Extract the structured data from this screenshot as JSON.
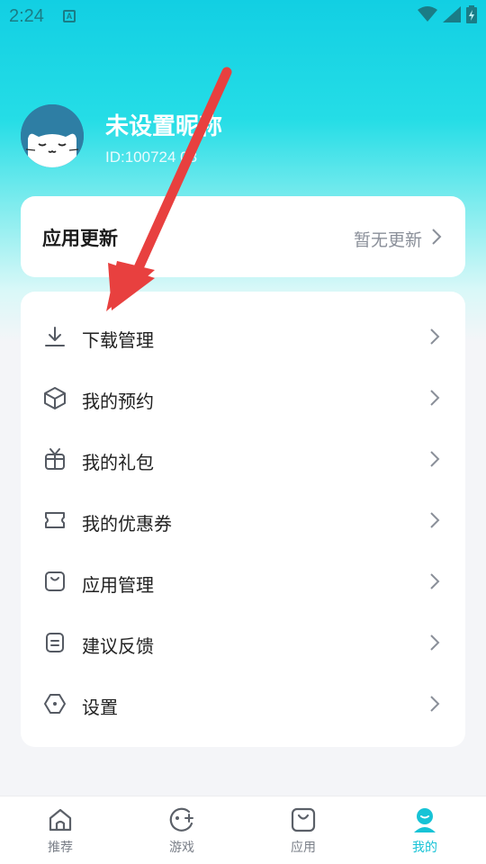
{
  "status_bar": {
    "time": "2:24",
    "badge": "A"
  },
  "profile": {
    "nickname": "未设置昵称",
    "user_id": "ID:100724 03"
  },
  "update_card": {
    "title": "应用更新",
    "status": "暂无更新"
  },
  "menu": {
    "items": [
      {
        "label": "下载管理",
        "icon": "download-icon"
      },
      {
        "label": "我的预约",
        "icon": "box-icon"
      },
      {
        "label": "我的礼包",
        "icon": "gift-icon"
      },
      {
        "label": "我的优惠券",
        "icon": "ticket-icon"
      },
      {
        "label": "应用管理",
        "icon": "bag-icon"
      },
      {
        "label": "建议反馈",
        "icon": "feedback-icon"
      },
      {
        "label": "设置",
        "icon": "settings-icon"
      }
    ]
  },
  "tabbar": {
    "tabs": [
      {
        "label": "推荐",
        "icon": "home-icon",
        "active": false
      },
      {
        "label": "游戏",
        "icon": "game-icon",
        "active": false
      },
      {
        "label": "应用",
        "icon": "bag-icon",
        "active": false
      },
      {
        "label": "我的",
        "icon": "profile-icon",
        "active": true
      }
    ]
  },
  "colors": {
    "accent": "#17c3d6",
    "annotation_arrow": "#e8403f"
  }
}
